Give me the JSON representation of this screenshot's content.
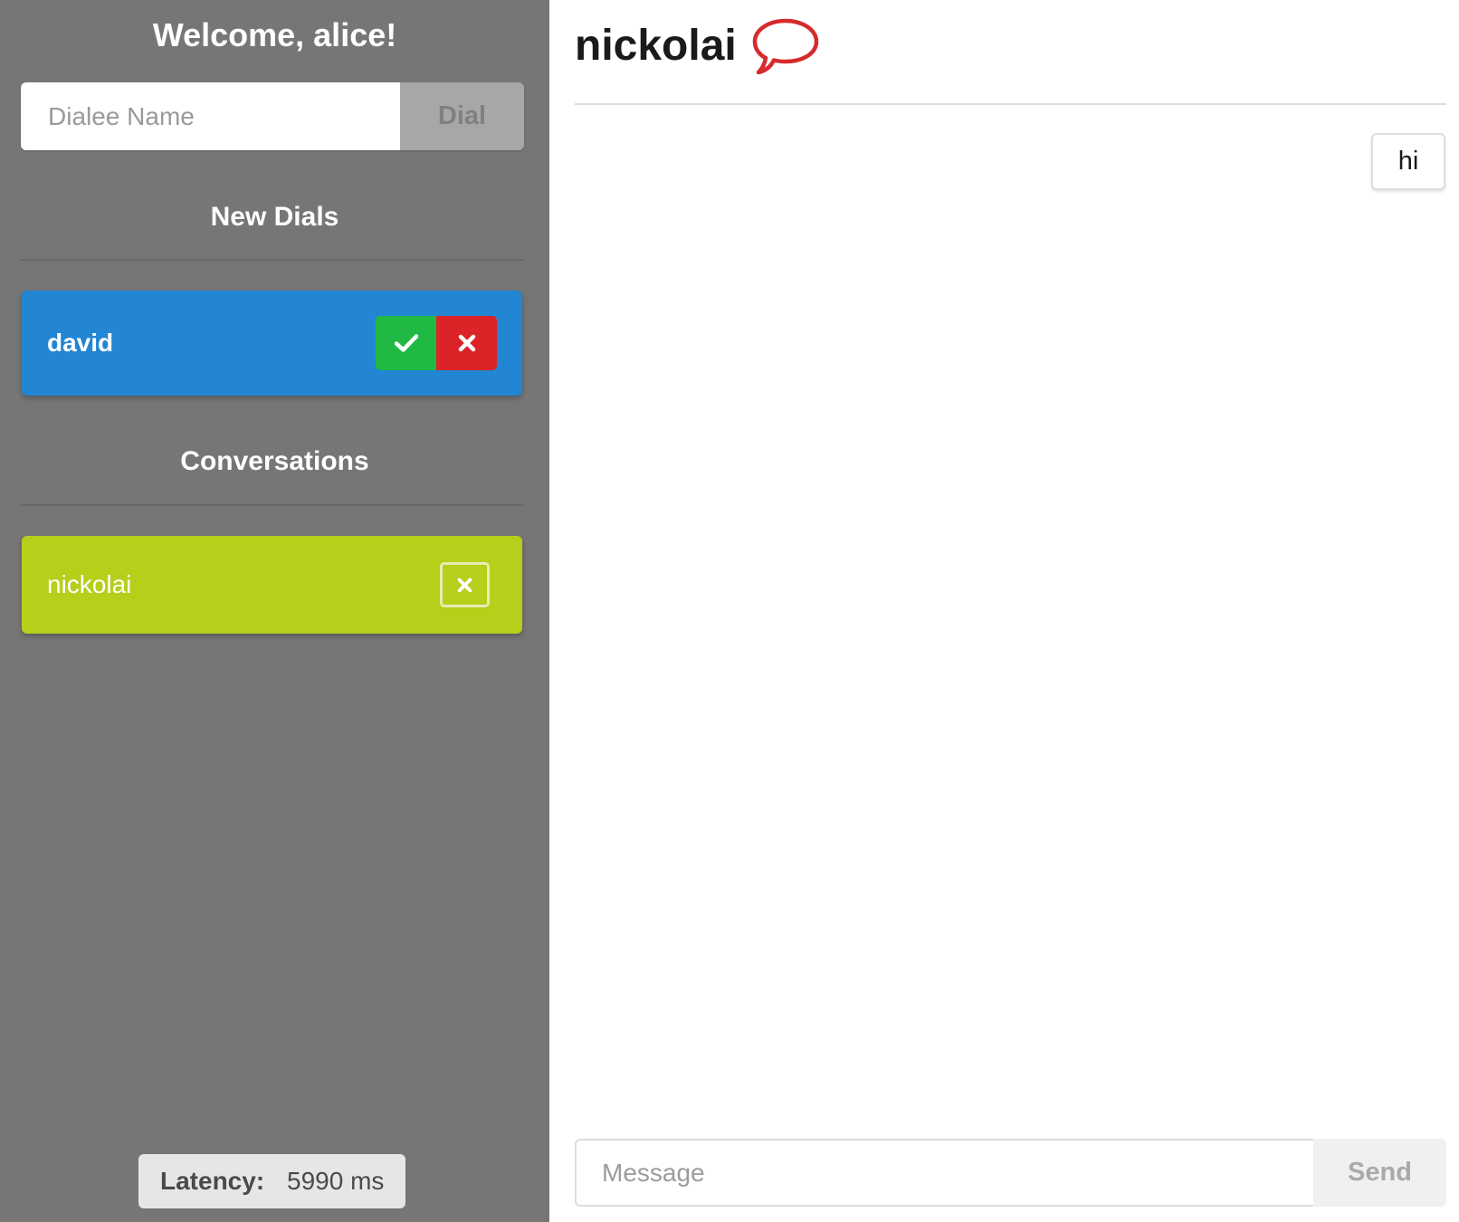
{
  "sidebar": {
    "welcome": "Welcome, alice!",
    "dial": {
      "placeholder": "Dialee Name",
      "value": "",
      "button_label": "Dial"
    },
    "new_dials": {
      "title": "New Dials",
      "items": [
        {
          "name": "david",
          "accept_icon": "check-icon",
          "reject_icon": "x-icon"
        }
      ]
    },
    "conversations": {
      "title": "Conversations",
      "items": [
        {
          "name": "nickolai",
          "close_icon": "x-icon"
        }
      ]
    },
    "latency": {
      "label": "Latency:",
      "value": "5990 ms"
    }
  },
  "chat": {
    "title": "nickolai",
    "title_icon": "speech-bubble-icon",
    "messages": [
      {
        "text": "hi",
        "side": "right"
      }
    ],
    "input": {
      "placeholder": "Message",
      "value": ""
    },
    "send_label": "Send"
  },
  "colors": {
    "sidebar_bg": "#767676",
    "dial_card": "#2286d2",
    "accept": "#1fb944",
    "reject": "#dc2327",
    "conversation_card": "#b5cf1b",
    "speech_icon": "#d62a2d"
  }
}
